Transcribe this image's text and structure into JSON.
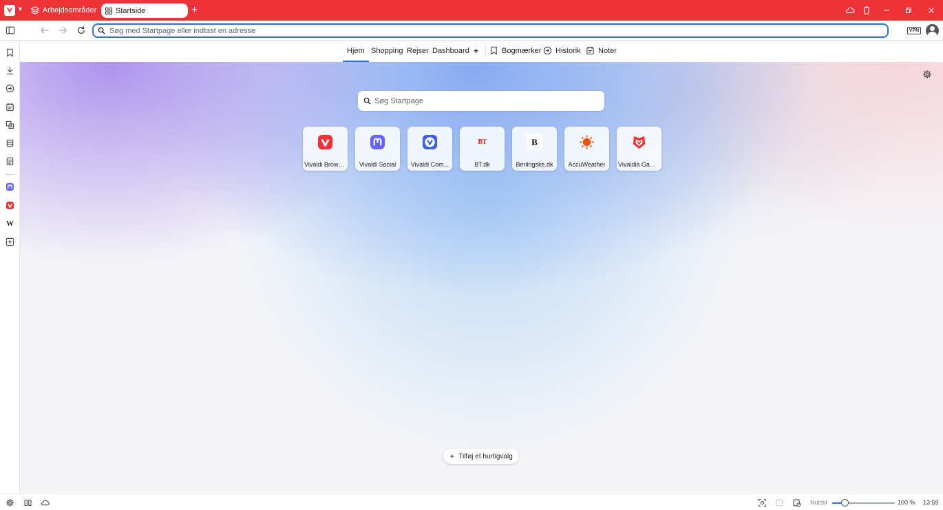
{
  "colors": {
    "accent": "#ee3338",
    "focus_blue": "#2d6fd6"
  },
  "tabbar": {
    "logo_icon": "vivaldi-logo-icon",
    "workspaces_label": "Arbejdsområder",
    "tabs": [
      {
        "label": "Startside",
        "icon": "speed-dial-grid-icon",
        "active": true
      }
    ],
    "controls": [
      "cloud-icon",
      "trash-icon",
      "minimize-icon",
      "restore-icon",
      "close-icon"
    ]
  },
  "addressbar": {
    "url_value": "",
    "url_placeholder": "Søg med Startpage eller indtast en adresse",
    "vpn_label": "VPN"
  },
  "sidebar": {
    "items": [
      "bookmarks-icon",
      "downloads-icon",
      "history-icon",
      "notes-icon",
      "translate-icon",
      "reading-list-icon",
      "window-panel-icon",
      "mastodon-icon",
      "vivaldi-icon",
      "wikipedia-icon",
      "add-panel-icon"
    ]
  },
  "startpage_nav": {
    "tabs": [
      {
        "label": "Hjem",
        "active": true
      },
      {
        "label": "Shopping"
      },
      {
        "label": "Rejser"
      },
      {
        "label": "Dashboard"
      }
    ],
    "add_label": "+",
    "tools": [
      {
        "label": "Bogmærker",
        "icon": "bookmark-icon"
      },
      {
        "label": "Historik",
        "icon": "history-icon"
      },
      {
        "label": "Noter",
        "icon": "notes-icon"
      }
    ]
  },
  "main": {
    "search_placeholder": "Søg Startpage",
    "bt_logo_text": "BT",
    "berlingske_logo_text": "B",
    "speed_dials": [
      {
        "label": "Vivaldi Browser",
        "icon": "vivaldi-icon"
      },
      {
        "label": "Vivaldi Social",
        "icon": "mastodon-icon"
      },
      {
        "label": "Vivaldi Com...",
        "icon": "vivaldi-community-icon"
      },
      {
        "label": "BT.dk",
        "icon": "bt-logo-icon"
      },
      {
        "label": "Berlingske.dk",
        "icon": "berlingske-logo-icon"
      },
      {
        "label": "AccuWeather",
        "icon": "sun-icon"
      },
      {
        "label": "Vivaldia Games",
        "icon": "vivaldia-games-icon"
      }
    ],
    "add_speed_dial_label": "Tilføj et hurtigvalg"
  },
  "statusbar": {
    "zoom_reset_label": "Nulstil",
    "zoom_level_percent": 100,
    "zoom_value": "100 %",
    "time": "13:59"
  }
}
